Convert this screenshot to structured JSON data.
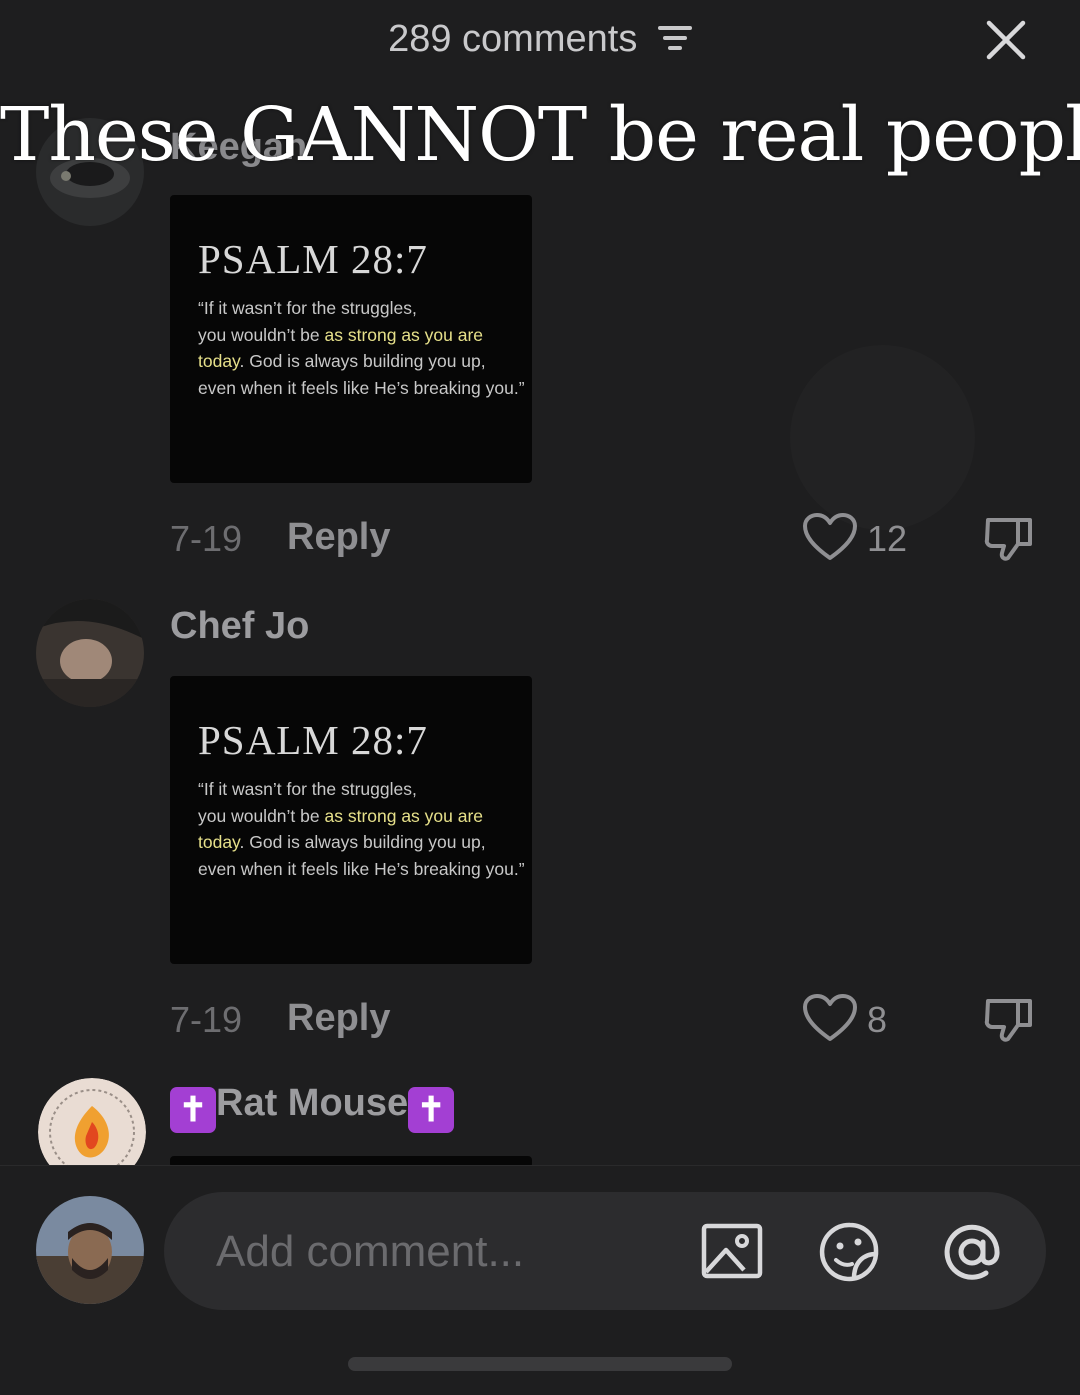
{
  "header": {
    "title": "289 comments",
    "sort_icon": "sort-lines-icon",
    "close_icon": "close-icon"
  },
  "overlay_caption": "These GANNOT be real people",
  "comments": [
    {
      "username": "Keegan",
      "card": {
        "title": "PSALM 28:7",
        "quote_pre": "“If it wasn’t for the struggles,\nyou wouldn’t be ",
        "quote_highlight": "as strong as you are\ntoday",
        "quote_post": ". God is always building you up,\neven when it feels like He’s breaking you.”"
      },
      "date": "7-19",
      "reply_label": "Reply",
      "likes": "12"
    },
    {
      "username": "Chef Jo",
      "card": {
        "title": "PSALM 28:7",
        "quote_pre": "“If it wasn’t for the struggles,\nyou wouldn’t be ",
        "quote_highlight": "as strong as you are\ntoday",
        "quote_post": ". God is always building you up,\neven when it feels like He’s breaking you.”"
      },
      "date": "7-19",
      "reply_label": "Reply",
      "likes": "8"
    },
    {
      "username_badge_left": "✝",
      "username": "Rat Mouse",
      "username_badge_right": "✝"
    }
  ],
  "composer": {
    "placeholder": "Add comment...",
    "icons": [
      "image-icon",
      "emoji-sticker-icon",
      "mention-at-icon"
    ]
  },
  "colors": {
    "background": "#1e1e1f",
    "highlight": "#e6e08a",
    "badge": "#a33fd3"
  }
}
